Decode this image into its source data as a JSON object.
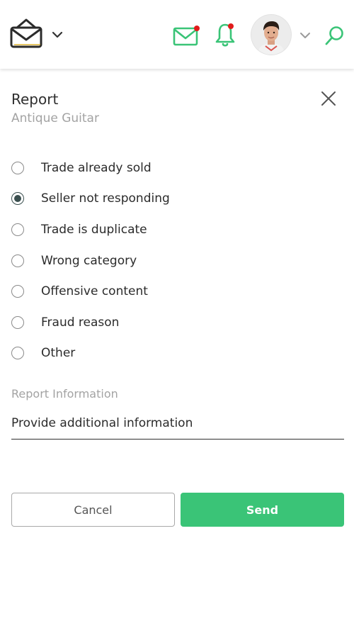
{
  "header": {
    "logo_icon": "shopping-bag-icon",
    "logo_menu_icon": "chevron-down-icon",
    "messages_icon": "envelope-icon",
    "notifications_icon": "bell-icon",
    "profile_menu_icon": "chevron-down-icon",
    "search_icon": "search-icon",
    "has_unread_messages": true,
    "has_unread_notifications": true,
    "colors": {
      "accent": "#3ac477",
      "badge": "#e11b1b",
      "logo": "#2b2b2b"
    }
  },
  "dialog": {
    "title": "Report",
    "subtitle": "Antique Guitar",
    "close_icon": "close-icon",
    "reasons": [
      {
        "label": "Trade already sold",
        "checked": false
      },
      {
        "label": "Seller not responding",
        "checked": true
      },
      {
        "label": "Trade is duplicate",
        "checked": false
      },
      {
        "label": "Wrong category",
        "checked": false
      },
      {
        "label": "Offensive content",
        "checked": false
      },
      {
        "label": "Fraud reason",
        "checked": false
      },
      {
        "label": "Other",
        "checked": false
      }
    ],
    "info_label": "Report Information",
    "info_placeholder": "Provide additional information",
    "info_value": "",
    "cancel_label": "Cancel",
    "send_label": "Send",
    "colors": {
      "send_bg": "#3ac477",
      "radio_checked": "#3b4f4f"
    }
  }
}
